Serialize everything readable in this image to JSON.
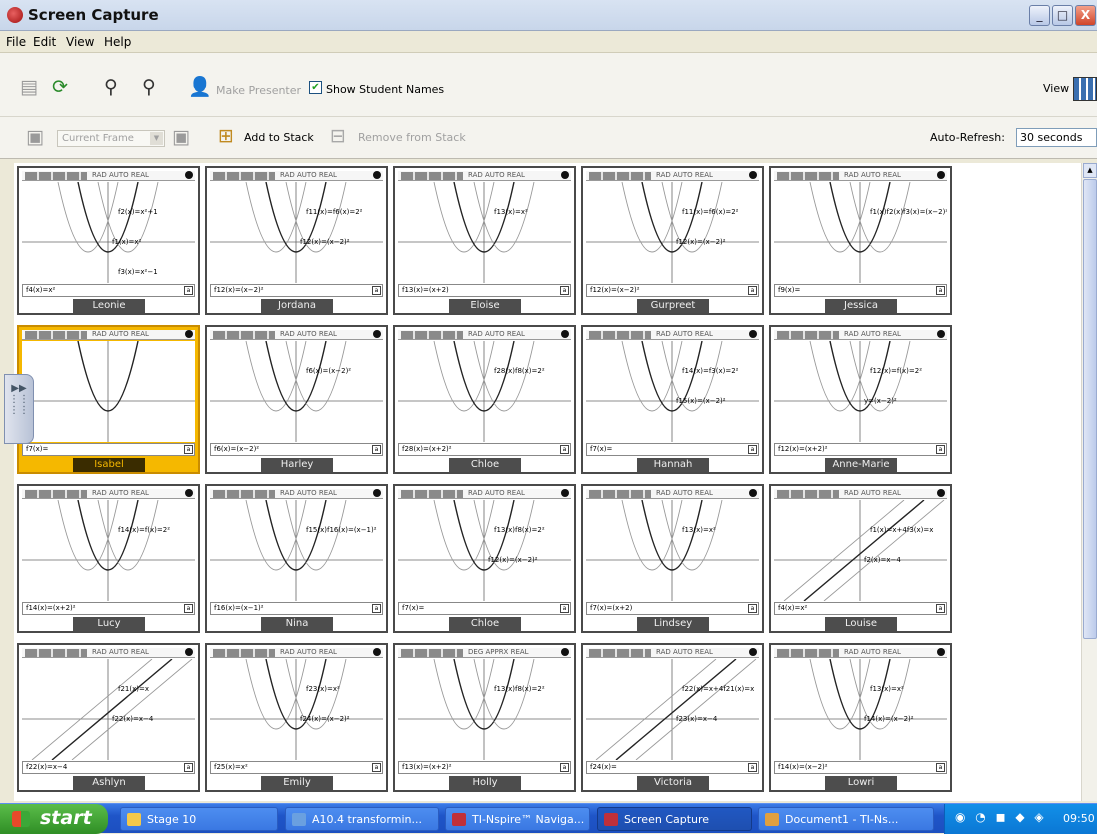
{
  "window": {
    "title": "Screen Capture",
    "minimize": "_",
    "maximize": "□",
    "close": "X"
  },
  "menu": [
    {
      "label": "File"
    },
    {
      "label": "Edit"
    },
    {
      "label": "View"
    },
    {
      "label": "Help"
    }
  ],
  "toolbar": {
    "make_presenter": "Make Presenter",
    "show_names_checked": true,
    "show_names_label": "Show Student Names",
    "view_label": "View"
  },
  "stackbar": {
    "frame_placeholder": "Current Frame",
    "add_stack": "Add to Stack",
    "remove_stack": "Remove from Stack",
    "auto_refresh_label": "Auto-Refresh:",
    "auto_refresh_value": "30 seconds"
  },
  "tiles": [
    {
      "name": "Leonie",
      "tabs": "RAD AUTO REAL",
      "entry": "f4(x)=x²",
      "labels": [
        "f2(x)=x²+1",
        "f1(x)=x²",
        "f3(x)=x²−1"
      ],
      "selected": false
    },
    {
      "name": "Jordana",
      "tabs": "RAD AUTO REAL",
      "entry": "f12(x)=(x−2)²",
      "labels": [
        "f11(x)=f6(x)=2²",
        "f12(x)=(x−2)²"
      ],
      "selected": false
    },
    {
      "name": "Eloise",
      "tabs": "RAD AUTO REAL",
      "entry": "f13(x)=(x+2)",
      "labels": [
        "f13(x)=x²"
      ],
      "selected": false
    },
    {
      "name": "Gurpreet",
      "tabs": "RAD AUTO REAL",
      "entry": "f12(x)=(x−2)²",
      "labels": [
        "f11(x)=f6(x)=2²",
        "f12(x)=(x−2)²"
      ],
      "selected": false
    },
    {
      "name": "Jessica",
      "tabs": "RAD AUTO REAL",
      "entry": "f9(x)=",
      "labels": [
        "f1(x)f2(x)f3(x)=(x−2)²"
      ],
      "selected": false
    },
    {
      "name": "Isabel",
      "tabs": "RAD AUTO REAL",
      "entry": "f7(x)=",
      "labels": [],
      "selected": true
    },
    {
      "name": "Harley",
      "tabs": "RAD AUTO REAL",
      "entry": "f6(x)=(x−2)²",
      "labels": [
        "f6(x)=(x−2)²"
      ],
      "selected": false
    },
    {
      "name": "Chloe",
      "tabs": "RAD AUTO REAL",
      "entry": "f28(x)=(x+2)²",
      "labels": [
        "f28(x)f8(x)=2²"
      ],
      "selected": false
    },
    {
      "name": "Hannah",
      "tabs": "RAD AUTO REAL",
      "entry": "f7(x)=",
      "labels": [
        "f14(x)=f3(x)=2²",
        "f15(x)=(x−2)²"
      ],
      "selected": false
    },
    {
      "name": "Anne-Marie",
      "tabs": "RAD AUTO REAL",
      "entry": "f12(x)=(x+2)²",
      "labels": [
        "f12(x)=f(x)=2²",
        "y=(x−2)²"
      ],
      "selected": false
    },
    {
      "name": "Lucy",
      "tabs": "RAD AUTO REAL",
      "entry": "f14(x)=(x+2)²",
      "labels": [
        "f14(x)=f(x)=2²"
      ],
      "selected": false
    },
    {
      "name": "Nina",
      "tabs": "RAD AUTO REAL",
      "entry": "f16(x)=(x−1)²",
      "labels": [
        "f15(x)f16(x)=(x−1)²"
      ],
      "selected": false
    },
    {
      "name": "Chloe",
      "tabs": "RAD AUTO REAL",
      "entry": "f7(x)=",
      "labels": [
        "f13(x)f8(x)=2²",
        "f12(x)=(x−2)²"
      ],
      "selected": false
    },
    {
      "name": "Lindsey",
      "tabs": "RAD AUTO REAL",
      "entry": "f7(x)=(x+2)",
      "labels": [
        "f13(x)=x²"
      ],
      "selected": false
    },
    {
      "name": "Louise",
      "tabs": "RAD AUTO REAL",
      "entry": "f4(x)=x²",
      "labels": [
        "f1(x)=x+4f3(x)=x",
        "f2(x)=x−4"
      ],
      "selected": false
    },
    {
      "name": "Ashlyn",
      "tabs": "RAD AUTO REAL",
      "entry": "f22(x)=x−4",
      "labels": [
        "f21(x)=x",
        "f22(x)=x−4"
      ],
      "selected": false
    },
    {
      "name": "Emily",
      "tabs": "RAD AUTO REAL",
      "entry": "f25(x)=x²",
      "labels": [
        "f23(x)=x²",
        "f24(x)=(x−2)²"
      ],
      "selected": false
    },
    {
      "name": "Holly",
      "tabs": "DEG APPRX REAL",
      "entry": "f13(x)=(x+2)²",
      "labels": [
        "f13(x)f8(x)=2²"
      ],
      "selected": false
    },
    {
      "name": "Victoria",
      "tabs": "RAD AUTO REAL",
      "entry": "f24(x)=",
      "labels": [
        "f22(x)=x+4f21(x)=x",
        "f23(x)=x−4"
      ],
      "selected": false
    },
    {
      "name": "Lowri",
      "tabs": "RAD AUTO REAL",
      "entry": "f14(x)=(x−2)²",
      "labels": [
        "f13(x)=x²",
        "f14(x)=(x−2)²"
      ],
      "selected": false
    }
  ],
  "taskbar": {
    "start": "start",
    "tasks": [
      {
        "label": "Stage 10",
        "color": "#f3c84a"
      },
      {
        "label": "A10.4 transformin...",
        "color": "#6aa0e0"
      },
      {
        "label": "TI-Nspire™ Naviga...",
        "color": "#c0303a"
      },
      {
        "label": "Screen Capture",
        "color": "#c0303a"
      },
      {
        "label": "Document1 - TI-Ns...",
        "color": "#e0a040"
      }
    ],
    "clock": "09:50"
  }
}
